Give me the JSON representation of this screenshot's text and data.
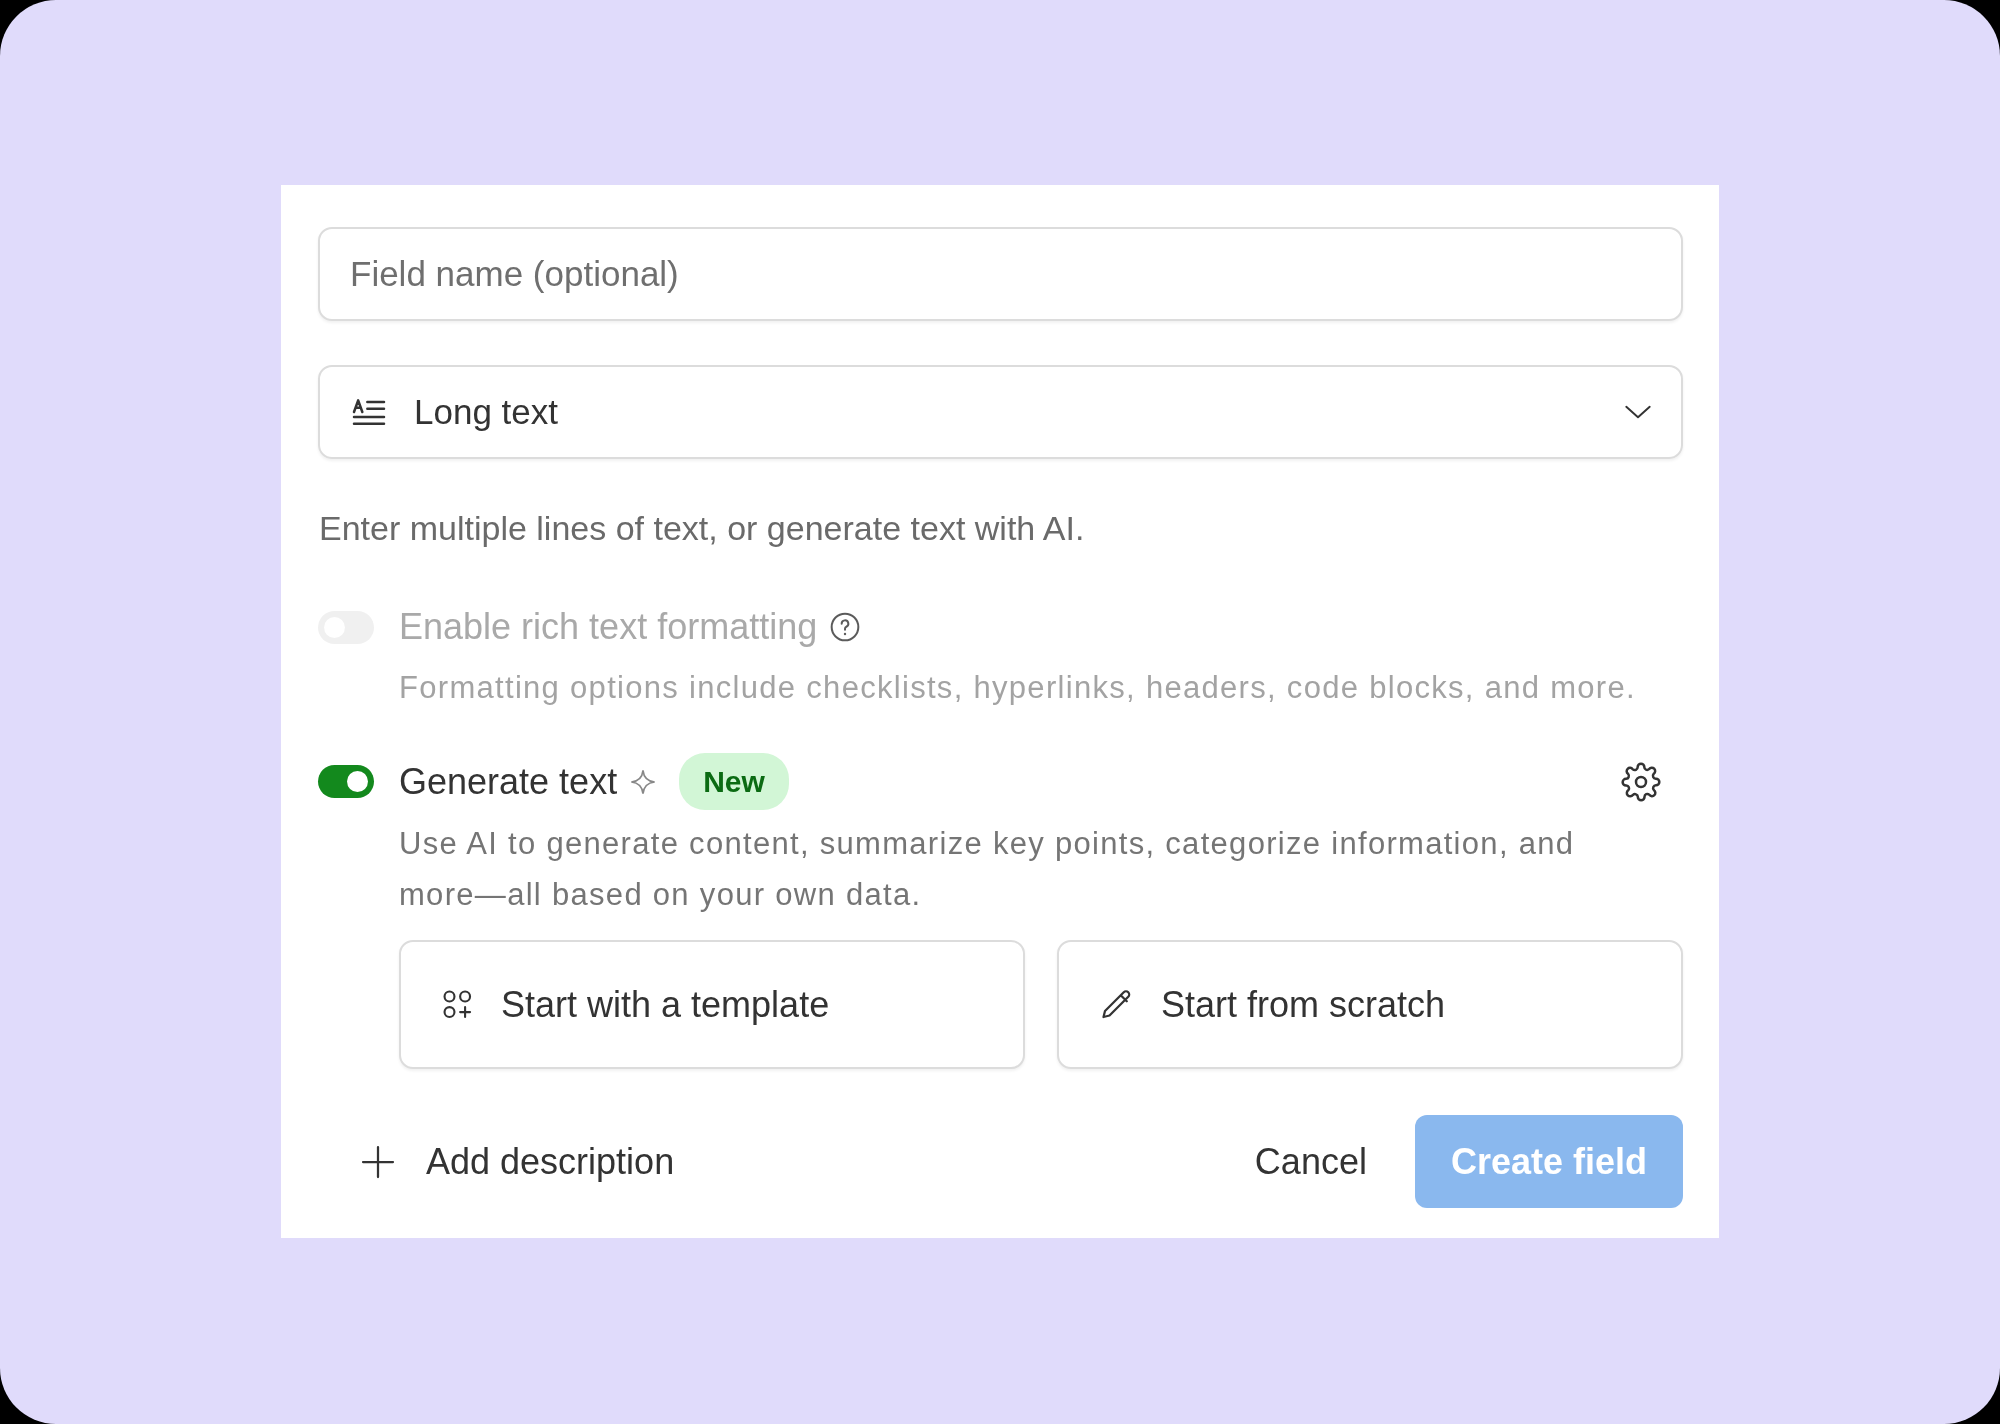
{
  "field_name": {
    "placeholder": "Field name (optional)"
  },
  "field_type": {
    "value": "Long text"
  },
  "type_description": "Enter multiple lines of text, or generate text with AI.",
  "options": [
    {
      "kind": "formatting",
      "label": "Enable rich text formatting",
      "on": false,
      "disabled": true,
      "description": "Formatting options include checklists, hyperlinks, headers, code blocks, and more."
    },
    {
      "kind": "ai",
      "label": "Generate text",
      "on": true,
      "disabled": false,
      "badge": "New",
      "description": "Use AI to generate content, summarize key points, categorize information, and more—all based on your own data.",
      "actions": [
        {
          "kind": "template",
          "label": "Start with a template"
        },
        {
          "kind": "scratch",
          "label": "Start from scratch"
        }
      ]
    }
  ],
  "footer": {
    "add_description": "Add description",
    "cancel": "Cancel",
    "create": {
      "label": "Create field",
      "disabled": true
    }
  }
}
